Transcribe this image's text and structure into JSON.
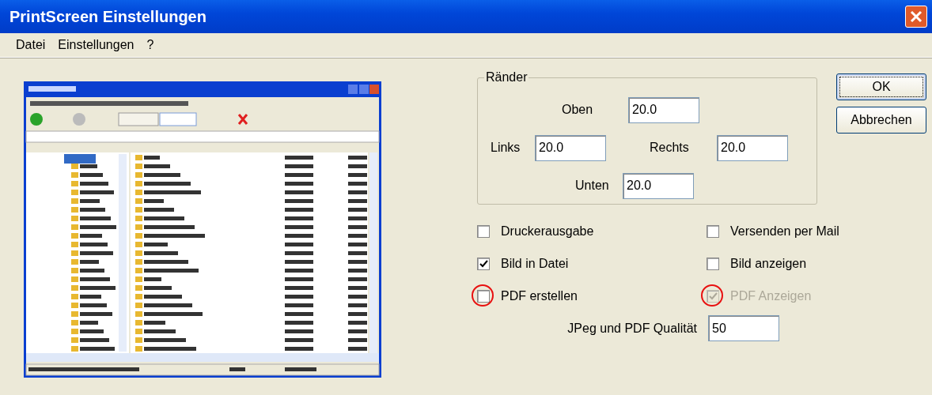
{
  "window": {
    "title": "PrintScreen Einstellungen"
  },
  "menu": [
    {
      "label": "Datei"
    },
    {
      "label": "Einstellungen"
    },
    {
      "label": "?"
    }
  ],
  "margins": {
    "title": "Ränder",
    "fields": [
      {
        "kind": "top",
        "label": "Oben",
        "value": "20.0"
      },
      {
        "kind": "left",
        "label": "Links",
        "value": "20.0"
      },
      {
        "kind": "right",
        "label": "Rechts",
        "value": "20.0"
      },
      {
        "kind": "bottom",
        "label": "Unten",
        "value": "20.0"
      }
    ]
  },
  "buttons": [
    {
      "label": "OK",
      "default": true
    },
    {
      "label": "Abbrechen",
      "default": false
    }
  ],
  "options": [
    {
      "label": "Druckerausgabe",
      "checked": false,
      "disabled": false,
      "highlighted": false
    },
    {
      "label": "Versenden per Mail",
      "checked": false,
      "disabled": false,
      "highlighted": false
    },
    {
      "label": "Bild in Datei",
      "checked": true,
      "disabled": false,
      "highlighted": false
    },
    {
      "label": "Bild anzeigen",
      "checked": false,
      "disabled": false,
      "highlighted": false
    },
    {
      "label": "PDF erstellen",
      "checked": false,
      "disabled": false,
      "highlighted": true
    },
    {
      "label": "PDF Anzeigen",
      "checked": true,
      "disabled": true,
      "highlighted": true
    }
  ],
  "quality": {
    "label": "JPeg und PDF Qualität",
    "value": "50"
  }
}
